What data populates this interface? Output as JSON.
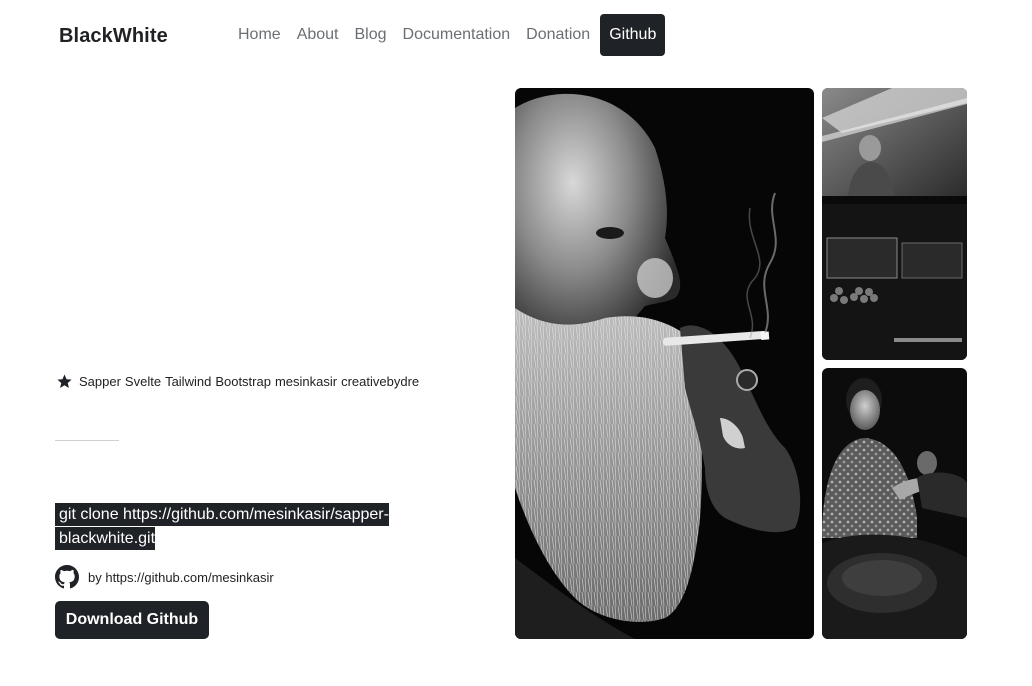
{
  "nav": {
    "brand": "BlackWhite",
    "items": [
      {
        "label": "Home"
      },
      {
        "label": "About"
      },
      {
        "label": "Blog"
      },
      {
        "label": "Documentation"
      },
      {
        "label": "Donation"
      },
      {
        "label": "Github",
        "active": true
      }
    ]
  },
  "hero": {
    "tags": [
      "Sapper",
      "Svelte",
      "Tailwind",
      "Bootstrap",
      "mesinkasir",
      "creativebydre"
    ],
    "clone_command": "git clone https://github.com/mesinkasir/sapper-blackwhite.git",
    "byline": "by https://github.com/mesinkasir",
    "download_label": "Download Github"
  },
  "gallery": {
    "images": [
      {
        "subject": "bearded old man smoking, black and white portrait"
      },
      {
        "subject": "market vendor with wares, black and white"
      },
      {
        "subject": "woman in patterned dress at market, black and white"
      }
    ]
  },
  "colors": {
    "dark": "#1f2226",
    "nav_text": "#6b6f74",
    "background": "#ffffff"
  }
}
